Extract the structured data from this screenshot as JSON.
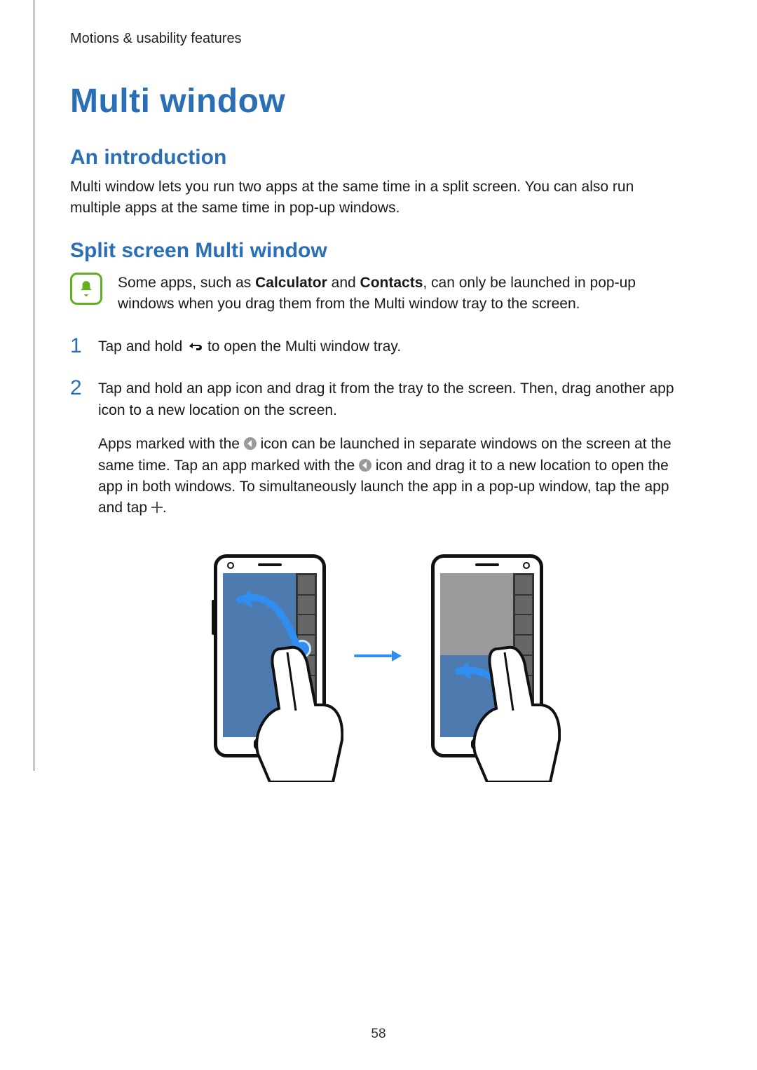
{
  "running_head": "Motions & usability features",
  "title": "Multi window",
  "sections": {
    "intro": {
      "heading": "An introduction",
      "body": "Multi window lets you run two apps at the same time in a split screen. You can also run multiple apps at the same time in pop-up windows."
    },
    "split": {
      "heading": "Split screen Multi window",
      "note_pre": "Some apps, such as ",
      "note_bold1": "Calculator",
      "note_mid": " and ",
      "note_bold2": "Contacts",
      "note_post": ", can only be launched in pop-up windows when you drag them from the Multi window tray to the screen.",
      "steps": {
        "s1": {
          "num": "1",
          "pre": "Tap and hold ",
          "post": " to open the Multi window tray."
        },
        "s2": {
          "num": "2",
          "line1": "Tap and hold an app icon and drag it from the tray to the screen. Then, drag another app icon to a new location on the screen.",
          "extra_pre": "Apps marked with the ",
          "extra_mid1": " icon can be launched in separate windows on the screen at the same time. Tap an app marked with the ",
          "extra_mid2": " icon and drag it to a new location to open the app in both windows. To simultaneously launch the app in a pop-up window, tap the app and tap ",
          "extra_post": "."
        }
      }
    }
  },
  "page_number": "58"
}
